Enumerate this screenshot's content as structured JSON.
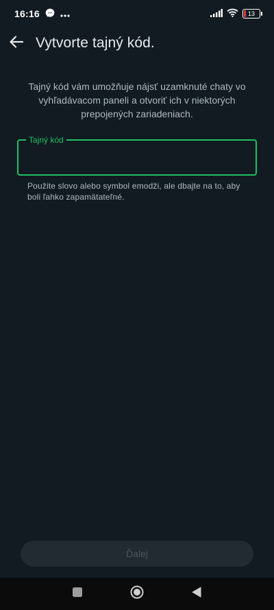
{
  "status_bar": {
    "time": "16:16",
    "messenger_icon": "messenger-icon",
    "more_icon": "more-dots-icon",
    "signal_icon": "signal-icon",
    "wifi_icon": "wifi-icon",
    "battery_level": "13",
    "battery_fraction": 0.13
  },
  "app_bar": {
    "back_icon": "arrow-back-icon",
    "title": "Vytvorte tajný kód."
  },
  "description": "Tajný kód vám umožňuje nájsť uzamknuté chaty vo vyhľadávacom paneli a otvoriť ich v niektorých prepojených zariadeniach.",
  "code_field": {
    "label": "Tajný kód",
    "value": ""
  },
  "helper_text": "Použite slovo alebo symbol emodži, ale dbajte na to, aby boli ľahko zapamätateľné.",
  "next_button": {
    "label": "Ďalej",
    "enabled": false
  },
  "nav_bar": {
    "recents_icon": "square-icon",
    "home_icon": "circle-icon",
    "back_icon": "triangle-back-icon"
  },
  "colors": {
    "background": "#121b22",
    "accent": "#21c063",
    "text_secondary": "#aebac1",
    "button_disabled": "#212b31"
  }
}
